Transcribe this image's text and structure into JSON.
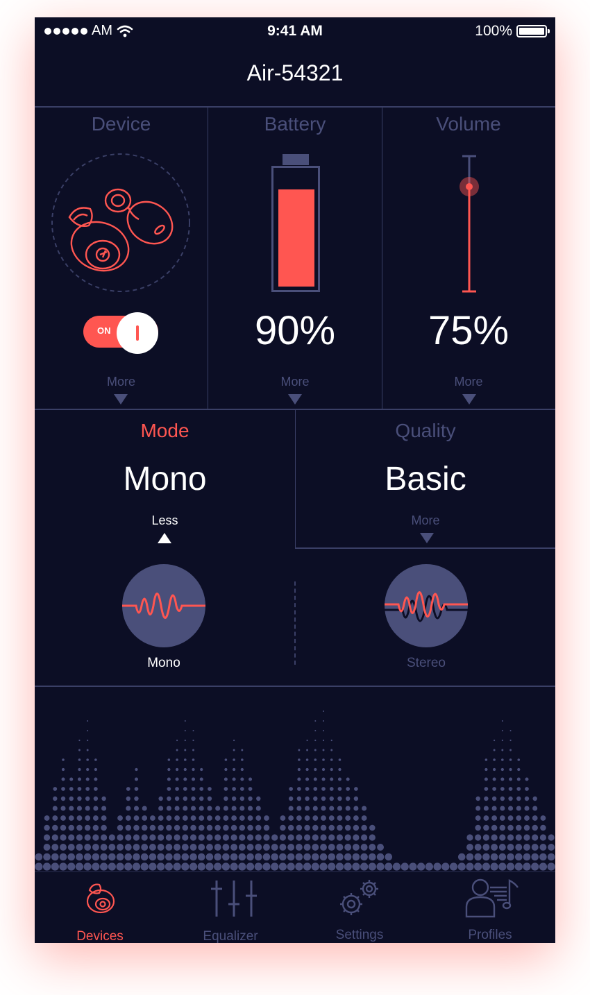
{
  "status": {
    "carrier": "AM",
    "time": "9:41 AM",
    "battery": "100%"
  },
  "header": {
    "title": "Air-54321"
  },
  "device_panel": {
    "title": "Device",
    "toggle_label": "ON",
    "toggle_on": true,
    "more": "More"
  },
  "battery_panel": {
    "title": "Battery",
    "value": "90%",
    "level": 0.9,
    "more": "More"
  },
  "volume_panel": {
    "title": "Volume",
    "value": "75%",
    "level": 0.75,
    "more": "More"
  },
  "mode_panel": {
    "title": "Mode",
    "value": "Mono",
    "less": "Less"
  },
  "quality_panel": {
    "title": "Quality",
    "value": "Basic",
    "more": "More"
  },
  "mode_options": [
    {
      "label": "Mono",
      "selected": true
    },
    {
      "label": "Stereo",
      "selected": false
    }
  ],
  "tabs": [
    {
      "label": "Devices",
      "icon": "earbud-icon",
      "active": true
    },
    {
      "label": "Equalizer",
      "icon": "sliders-icon",
      "active": false
    },
    {
      "label": "Settings",
      "icon": "gears-icon",
      "active": false
    },
    {
      "label": "Profiles",
      "icon": "profile-music-icon",
      "active": false
    }
  ],
  "colors": {
    "background": "#0c0e25",
    "accent": "#ff5651",
    "muted": "#4a4f7a",
    "divider": "#3a3f66"
  }
}
